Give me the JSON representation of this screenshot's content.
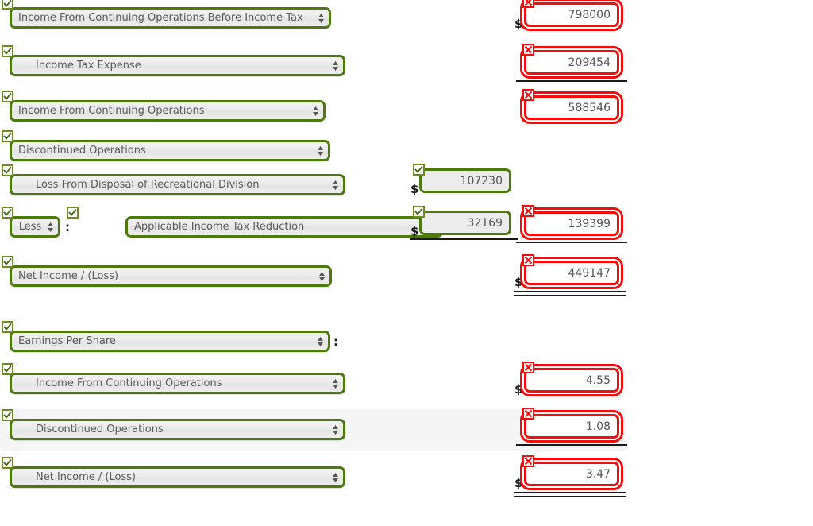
{
  "colors": {
    "correct_border": "#4c7a0b",
    "correct_badge_border": "#6d8c1b",
    "incorrect_border": "#f40d0d",
    "select_text": "#5a5a5a",
    "stripe_background": "#f5f5f5",
    "page_background": "#ffffff"
  },
  "symbols": {
    "dollar": "$",
    "colon": ":",
    "check": "check-mark",
    "cross": "cross-mark"
  },
  "rows": [
    {
      "id": "income-before-tax",
      "label": "Income From Continuing Operations Before Income Tax",
      "label_status": "correct",
      "indent": 0,
      "select_width": 405,
      "amount": "798000",
      "amount_status": "incorrect",
      "dollar": true,
      "rule": "none",
      "striped": false
    },
    {
      "id": "income-tax-expense",
      "label": "Income Tax Expense",
      "label_status": "correct",
      "indent": 1,
      "select_width": 423,
      "amount": "209454",
      "amount_status": "incorrect",
      "dollar": false,
      "rule": "single",
      "striped": false
    },
    {
      "id": "income-continuing-operations",
      "label": "Income From Continuing Operations",
      "label_status": "correct",
      "indent": 0,
      "select_width": 398,
      "amount": "588546",
      "amount_status": "incorrect",
      "dollar": false,
      "rule": "none",
      "striped": false
    },
    {
      "id": "discontinued-operations",
      "label": "Discontinued Operations",
      "label_status": "correct",
      "indent": 0,
      "select_width": 404,
      "amount": null,
      "amount_status": "none",
      "dollar": false,
      "rule": "none",
      "striped": false
    },
    {
      "id": "loss-disposal-recreational",
      "label": "Loss From Disposal of Recreational Division",
      "label_status": "correct",
      "indent": 1,
      "select_width": 423,
      "sub_amount": "107230",
      "sub_amount_status": "correct",
      "sub_dollar": true,
      "amount": null,
      "amount_status": "none",
      "dollar": false,
      "rule": "none",
      "striped": false
    },
    {
      "id": "applicable-income-tax-reduction",
      "prefix_label": "Less",
      "prefix_status": "correct",
      "prefix_width": 64,
      "label": "Applicable Income Tax Reduction",
      "label_status": "correct",
      "indent": 0,
      "select_width": 400,
      "sub_amount": "32169",
      "sub_amount_status": "correct",
      "sub_rule": "single",
      "amount": "139399",
      "amount_status": "incorrect",
      "dollar": false,
      "rule": "single",
      "striped": false
    },
    {
      "id": "net-income-loss",
      "label": "Net Income / (Loss)",
      "label_status": "correct",
      "indent": 0,
      "select_width": 406,
      "amount": "449147",
      "amount_status": "incorrect",
      "dollar": true,
      "rule": "double",
      "striped": false
    },
    {
      "id": "earnings-per-share-header",
      "label": "Earnings Per Share",
      "label_status": "correct",
      "indent": 0,
      "select_width": 404,
      "trailing_colon": true,
      "amount": null,
      "amount_status": "none",
      "dollar": false,
      "rule": "none",
      "striped": false
    },
    {
      "id": "eps-income-continuing-operations",
      "label": "Income From Continuing Operations",
      "label_status": "correct",
      "indent": 1,
      "select_width": 423,
      "amount": "4.55",
      "amount_status": "incorrect",
      "dollar": true,
      "rule": "none",
      "striped": false
    },
    {
      "id": "eps-discontinued-operations",
      "label": "Discontinued Operations",
      "label_status": "correct",
      "indent": 1,
      "select_width": 423,
      "amount": "1.08",
      "amount_status": "incorrect",
      "dollar": false,
      "rule": "single",
      "striped": true
    },
    {
      "id": "eps-net-income-loss",
      "label": "Net Income / (Loss)",
      "label_status": "correct",
      "indent": 1,
      "select_width": 423,
      "amount": "3.47",
      "amount_status": "incorrect",
      "dollar": true,
      "rule": "double",
      "striped": false
    }
  ]
}
